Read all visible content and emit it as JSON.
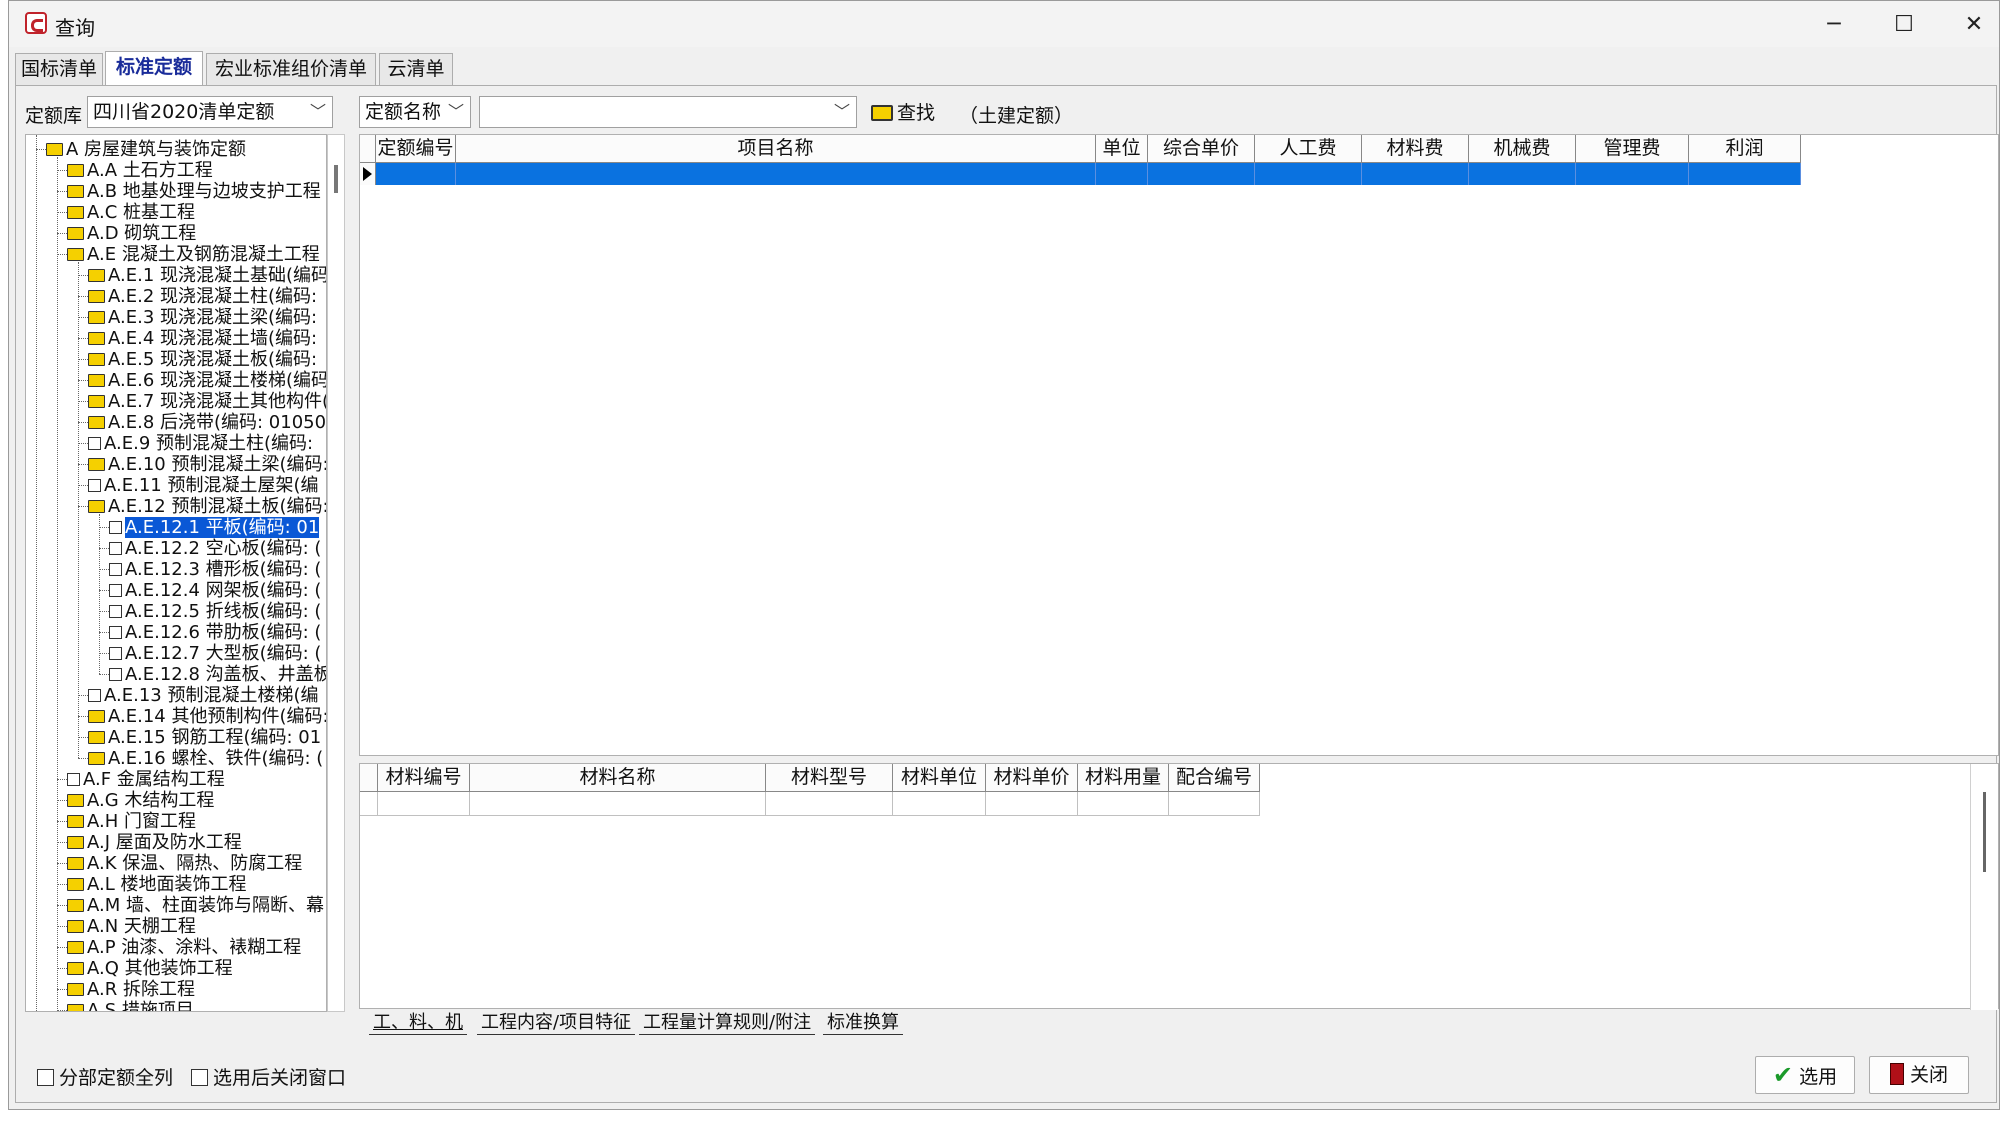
{
  "window": {
    "title": "查询"
  },
  "window_controls": {
    "minimize": "─",
    "maximize": "☐",
    "close": "✕"
  },
  "tabs": [
    "国标清单",
    "标准定额",
    "宏业标准组价清单",
    "云清单"
  ],
  "active_tab": 1,
  "toolbar": {
    "library_label": "定额库",
    "library_value": "四川省2020清单定额",
    "field_select": "定额名称",
    "search_value": "",
    "search_label": "查找",
    "scope_label": "（土建定额）"
  },
  "tree": [
    {
      "label": "A 房屋建筑与装饰定额",
      "icon": "folder-open-icon",
      "level": 0
    },
    {
      "label": "A.A 土石方工程",
      "icon": "folder-icon",
      "level": 1
    },
    {
      "label": "A.B 地基处理与边坡支护工程",
      "icon": "folder-icon",
      "level": 1
    },
    {
      "label": "A.C 桩基工程",
      "icon": "folder-icon",
      "level": 1
    },
    {
      "label": "A.D 砌筑工程",
      "icon": "folder-icon",
      "level": 1
    },
    {
      "label": "A.E 混凝土及钢筋混凝土工程",
      "icon": "folder-open-icon",
      "level": 1
    },
    {
      "label": "A.E.1 现浇混凝土基础(编码",
      "icon": "folder-icon",
      "level": 2
    },
    {
      "label": "A.E.2 现浇混凝土柱(编码:",
      "icon": "folder-icon",
      "level": 2
    },
    {
      "label": "A.E.3 现浇混凝土梁(编码:",
      "icon": "folder-icon",
      "level": 2
    },
    {
      "label": "A.E.4 现浇混凝土墙(编码:",
      "icon": "folder-icon",
      "level": 2
    },
    {
      "label": "A.E.5 现浇混凝土板(编码:",
      "icon": "folder-icon",
      "level": 2
    },
    {
      "label": "A.E.6 现浇混凝土楼梯(编码",
      "icon": "folder-icon",
      "level": 2
    },
    {
      "label": "A.E.7 现浇混凝土其他构件(",
      "icon": "folder-icon",
      "level": 2
    },
    {
      "label": "A.E.8 后浇带(编码: 01050",
      "icon": "folder-icon",
      "level": 2
    },
    {
      "label": "A.E.9 预制混凝土柱(编码:",
      "icon": "doc-icon",
      "level": 2
    },
    {
      "label": "A.E.10 预制混凝土梁(编码:",
      "icon": "folder-icon",
      "level": 2
    },
    {
      "label": "A.E.11 预制混凝土屋架(编",
      "icon": "doc-icon",
      "level": 2
    },
    {
      "label": "A.E.12 预制混凝土板(编码:",
      "icon": "folder-open-icon",
      "level": 2
    },
    {
      "label": "A.E.12.1 平板(编码: 01",
      "icon": "doc-icon",
      "level": 3,
      "selected": true
    },
    {
      "label": "A.E.12.2 空心板(编码: (",
      "icon": "doc-icon",
      "level": 3
    },
    {
      "label": "A.E.12.3 槽形板(编码: (",
      "icon": "doc-icon",
      "level": 3
    },
    {
      "label": "A.E.12.4 网架板(编码: (",
      "icon": "doc-icon",
      "level": 3
    },
    {
      "label": "A.E.12.5 折线板(编码: (",
      "icon": "doc-icon",
      "level": 3
    },
    {
      "label": "A.E.12.6 带肋板(编码: (",
      "icon": "doc-icon",
      "level": 3
    },
    {
      "label": "A.E.12.7 大型板(编码: (",
      "icon": "doc-icon",
      "level": 3
    },
    {
      "label": "A.E.12.8 沟盖板、井盖板",
      "icon": "doc-icon",
      "level": 3
    },
    {
      "label": "A.E.13 预制混凝土楼梯(编",
      "icon": "doc-icon",
      "level": 2
    },
    {
      "label": "A.E.14 其他预制构件(编码:",
      "icon": "folder-icon",
      "level": 2
    },
    {
      "label": "A.E.15 钢筋工程(编码: 01",
      "icon": "folder-icon",
      "level": 2
    },
    {
      "label": "A.E.16 螺栓、铁件(编码: (",
      "icon": "folder-icon",
      "level": 2
    },
    {
      "label": "A.F 金属结构工程",
      "icon": "doc-icon",
      "level": 1
    },
    {
      "label": "A.G 木结构工程",
      "icon": "folder-icon",
      "level": 1
    },
    {
      "label": "A.H 门窗工程",
      "icon": "folder-icon",
      "level": 1
    },
    {
      "label": "A.J 屋面及防水工程",
      "icon": "folder-icon",
      "level": 1
    },
    {
      "label": "A.K 保温、隔热、防腐工程",
      "icon": "folder-icon",
      "level": 1
    },
    {
      "label": "A.L 楼地面装饰工程",
      "icon": "folder-icon",
      "level": 1
    },
    {
      "label": "A.M 墙、柱面装饰与隔断、幕",
      "icon": "folder-icon",
      "level": 1
    },
    {
      "label": "A.N 天棚工程",
      "icon": "folder-icon",
      "level": 1
    },
    {
      "label": "A.P 油漆、涂料、裱糊工程",
      "icon": "folder-icon",
      "level": 1
    },
    {
      "label": "A.Q 其他装饰工程",
      "icon": "folder-icon",
      "level": 1
    },
    {
      "label": "A.R 拆除工程",
      "icon": "folder-icon",
      "level": 1
    },
    {
      "label": "A.S 措施项目",
      "icon": "folder-icon",
      "level": 1
    }
  ],
  "main_grid": {
    "columns": [
      "定额编号",
      "项目名称",
      "单位",
      "综合单价",
      "人工费",
      "材料费",
      "机械费",
      "管理费",
      "利润"
    ],
    "rows": [
      [
        "",
        "",
        "",
        "",
        "",
        "",
        "",
        "",
        ""
      ]
    ],
    "selected_row_color": "#0a72e0"
  },
  "material_grid": {
    "columns": [
      "材料编号",
      "材料名称",
      "材料型号",
      "材料单位",
      "材料单价",
      "材料用量",
      "配合编号"
    ],
    "rows": [
      [
        "",
        "",
        "",
        "",
        "",
        "",
        ""
      ]
    ]
  },
  "bottom_tabs": [
    "工、料、机",
    "工程内容/项目特征",
    "工程量计算规则/附注",
    "标准换算"
  ],
  "options": {
    "show_all": "分部定额全列",
    "close_after_select": "选用后关闭窗口"
  },
  "buttons": {
    "select": "选用",
    "close": "关闭"
  },
  "colors": {
    "selection": "#0a58d6",
    "title_accent": "#1a2c9a",
    "check": "#1a9a2a",
    "close_icon": "#b01018"
  }
}
